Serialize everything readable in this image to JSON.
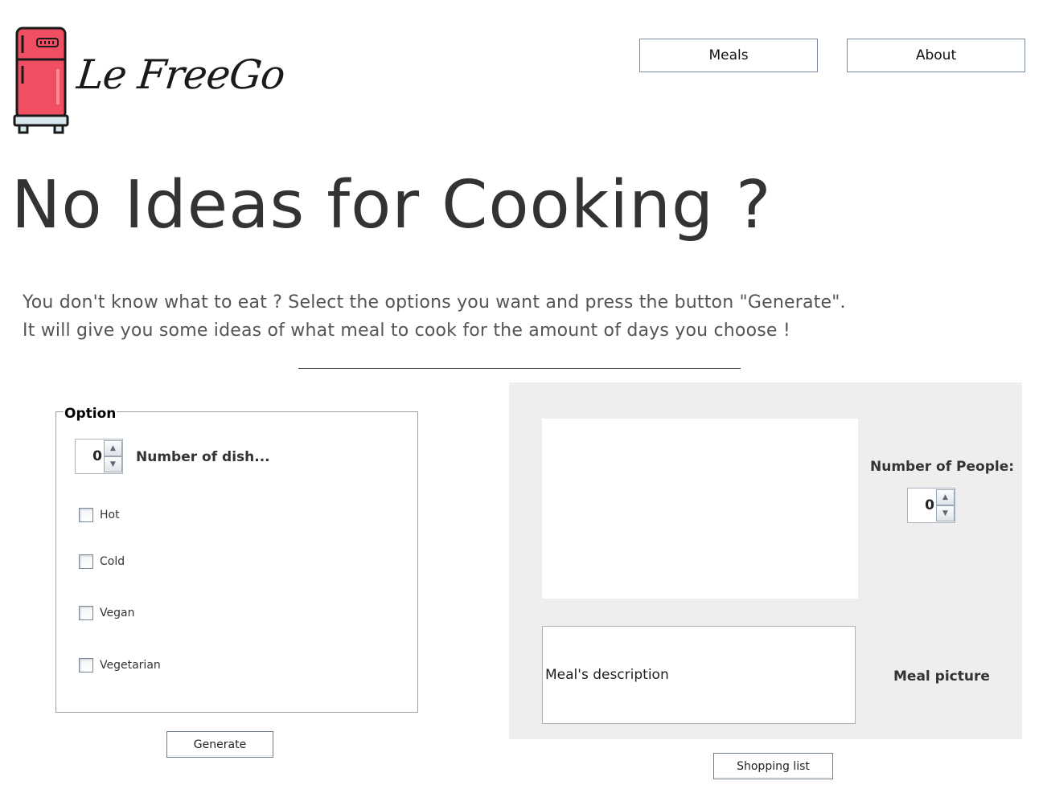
{
  "brand": {
    "name": "Le FreeGo",
    "logo_icon": "fridge-icon",
    "fridge_color": "#f04f63"
  },
  "nav": {
    "meals_label": "Meals",
    "about_label": "About"
  },
  "hero": {
    "title": "No Ideas for Cooking ?",
    "intro_line_1": "You don't know what to eat ? Select the options you want and press the button \"Generate\".",
    "intro_line_2": "It will give you some ideas of what meal to cook for the amount of days you choose !"
  },
  "options": {
    "legend": "Option",
    "dishes": {
      "value": "0",
      "label": "Number of dish..."
    },
    "checkboxes": [
      {
        "label": "Hot",
        "checked": false
      },
      {
        "label": "Cold",
        "checked": false
      },
      {
        "label": "Vegan",
        "checked": false
      },
      {
        "label": "Vegetarian",
        "checked": false
      }
    ],
    "generate_label": "Generate"
  },
  "result": {
    "people_label": "Number of People:",
    "people_value": "0",
    "description_text": "Meal's description",
    "picture_label": "Meal picture",
    "shopping_label": "Shopping list",
    "panel_color": "#eeeeee"
  }
}
